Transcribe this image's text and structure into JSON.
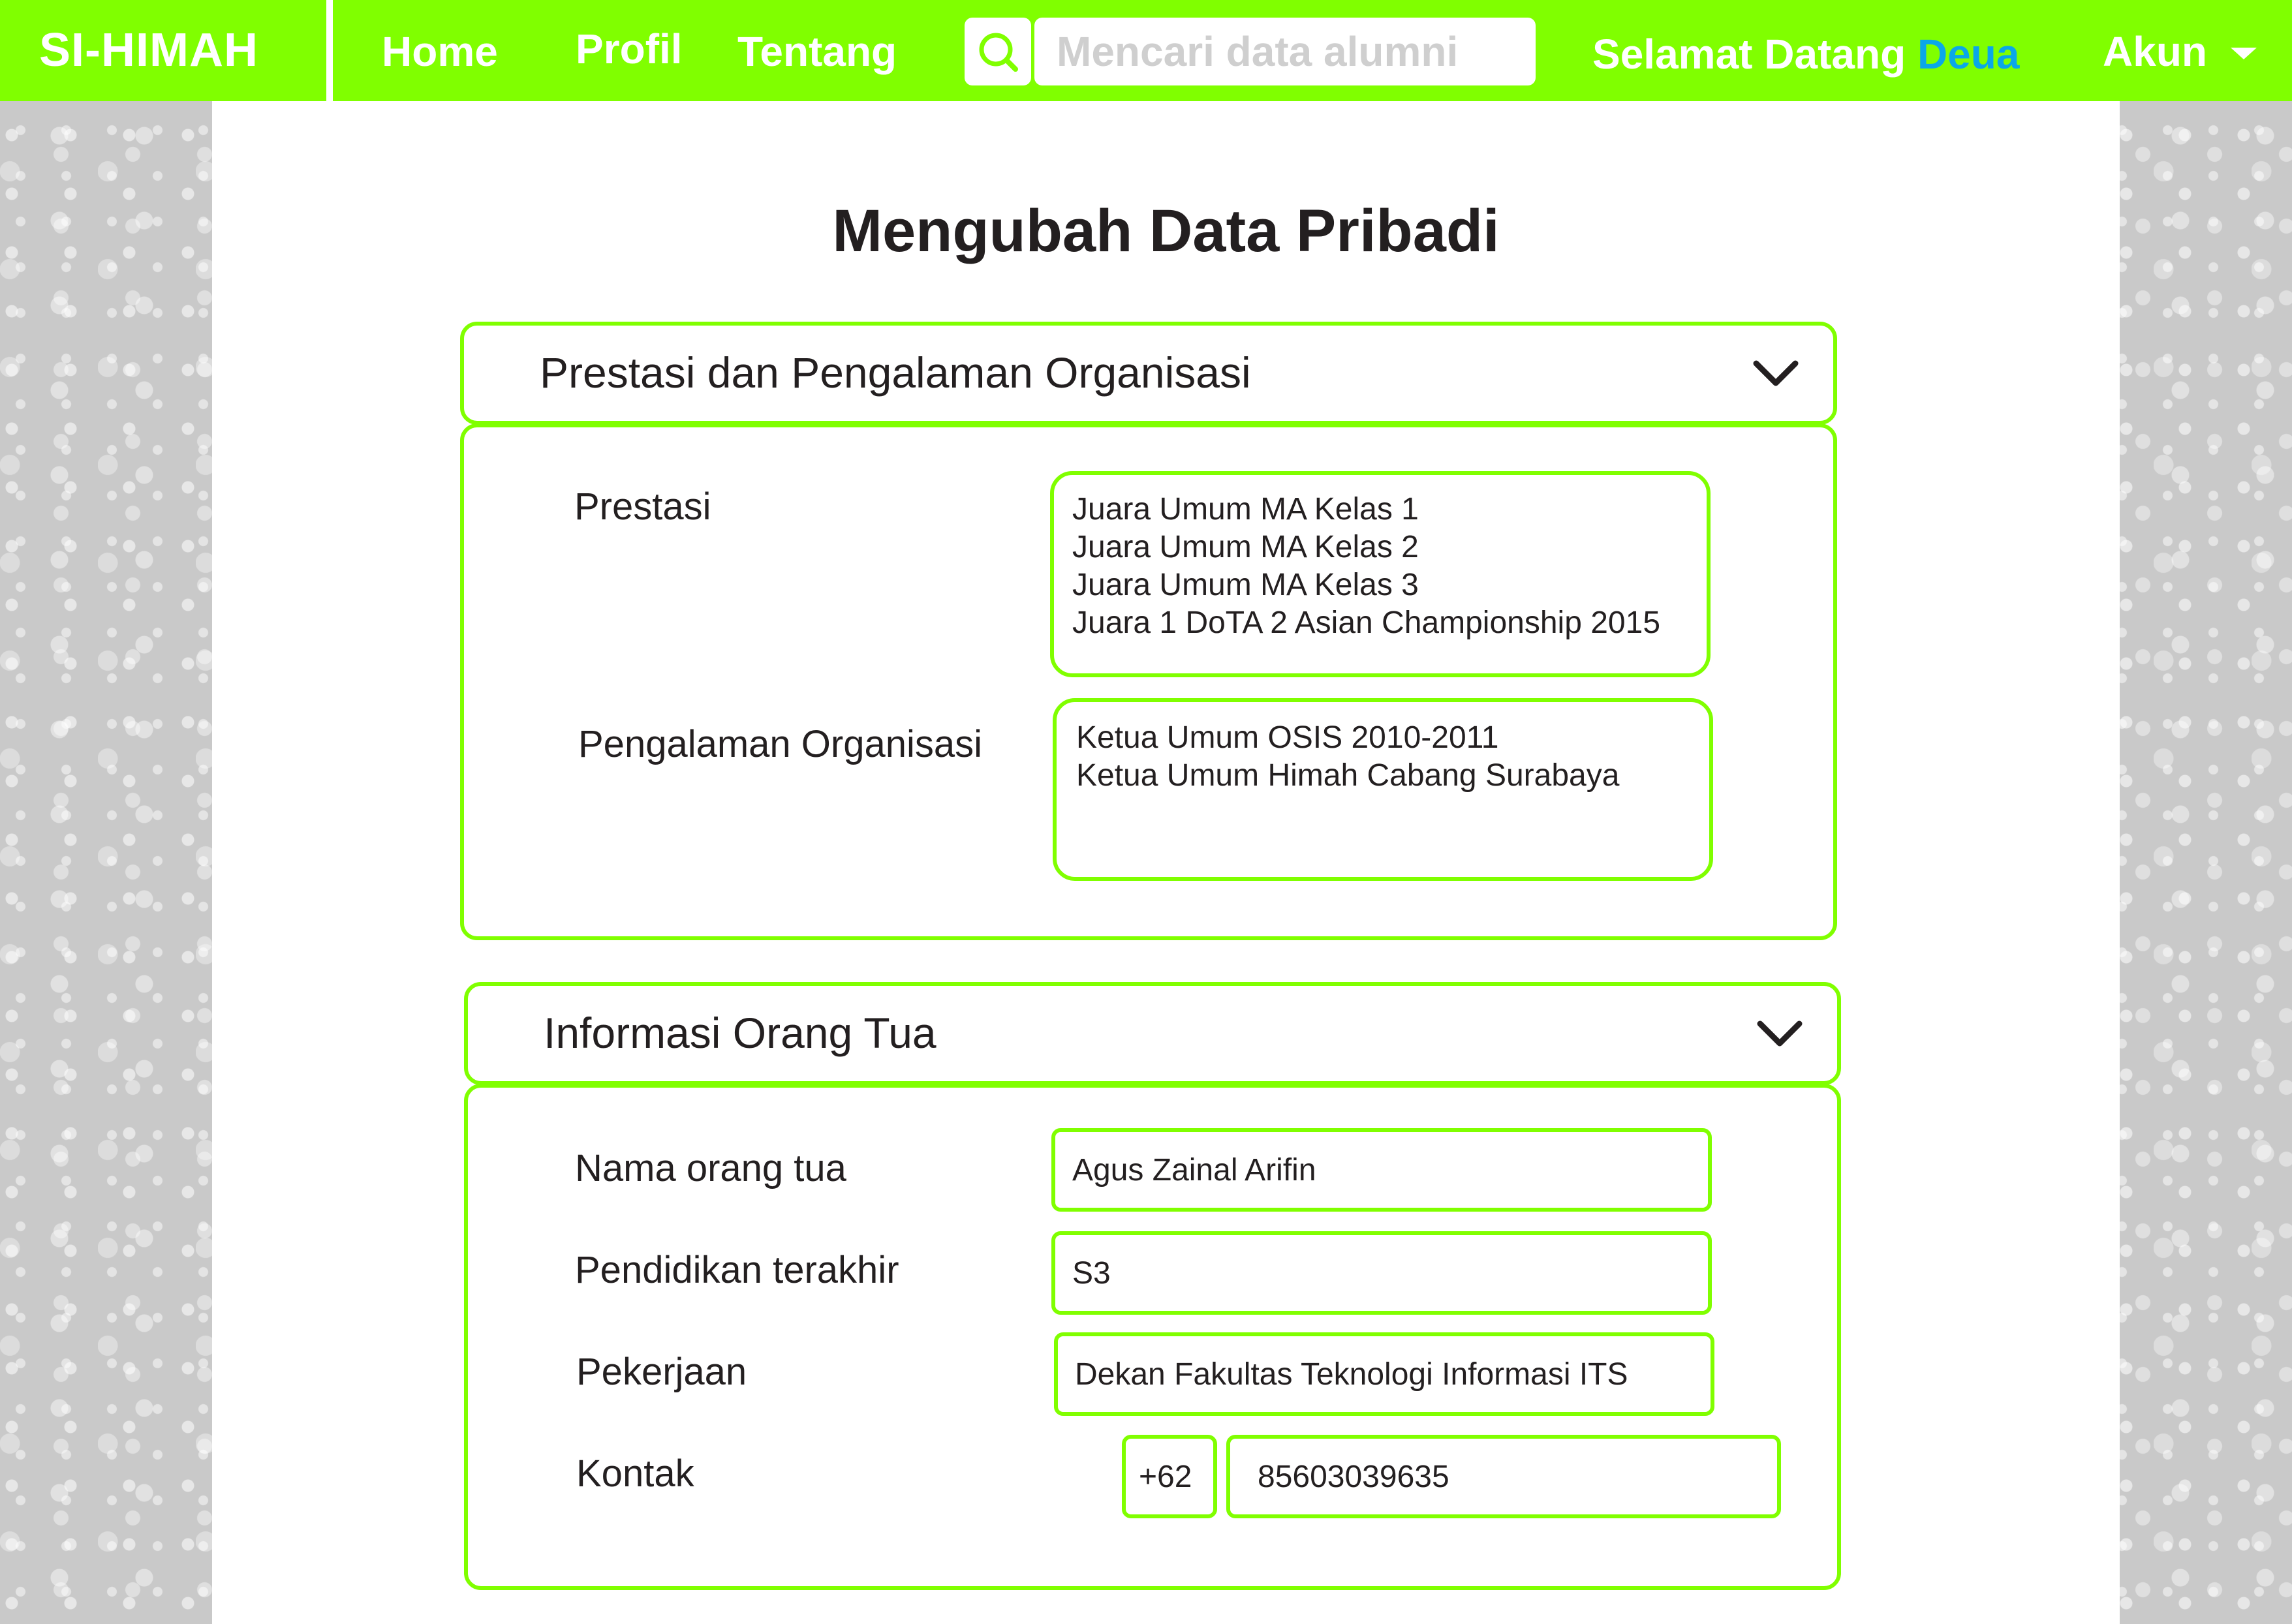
{
  "navbar": {
    "brand": "SI-HIMAH",
    "links": {
      "home": "Home",
      "profil": "Profil",
      "tentang": "Tentang"
    },
    "search": {
      "placeholder": "Mencari data alumni",
      "value": ""
    },
    "welcome": {
      "prefix": "Selamat Datang",
      "name": "Deua"
    },
    "account": "Akun"
  },
  "page": {
    "title": "Mengubah Data Pribadi"
  },
  "section_prestasi": {
    "title": "Prestasi dan Pengalaman Organisasi",
    "prestasi_label": "Prestasi",
    "prestasi_value": "Juara Umum MA Kelas 1\nJuara Umum MA Kelas 2\nJuara Umum MA Kelas 3\nJuara 1 DoTA 2 Asian Championship 2015",
    "organisasi_label": "Pengalaman Organisasi",
    "organisasi_value": "Ketua Umum OSIS 2010-2011\nKetua Umum Himah Cabang Surabaya"
  },
  "section_orangtua": {
    "title": "Informasi Orang Tua",
    "nama_label": "Nama orang tua",
    "nama_value": "Agus Zainal Arifin",
    "pendidikan_label": "Pendidikan terakhir",
    "pendidikan_value": "S3",
    "pekerjaan_label": "Pekerjaan",
    "pekerjaan_value": "Dekan Fakultas Teknologi Informasi ITS",
    "kontak_label": "Kontak",
    "kontak_prefix": "+62",
    "kontak_value": "85603039635"
  },
  "colors": {
    "accent": "#80ff00",
    "highlight": "#0aa7e8",
    "text": "#231f20"
  },
  "icons": {
    "search": "search-icon",
    "dropdown": "caret-down-icon",
    "accordion": "chevron-down-icon"
  }
}
